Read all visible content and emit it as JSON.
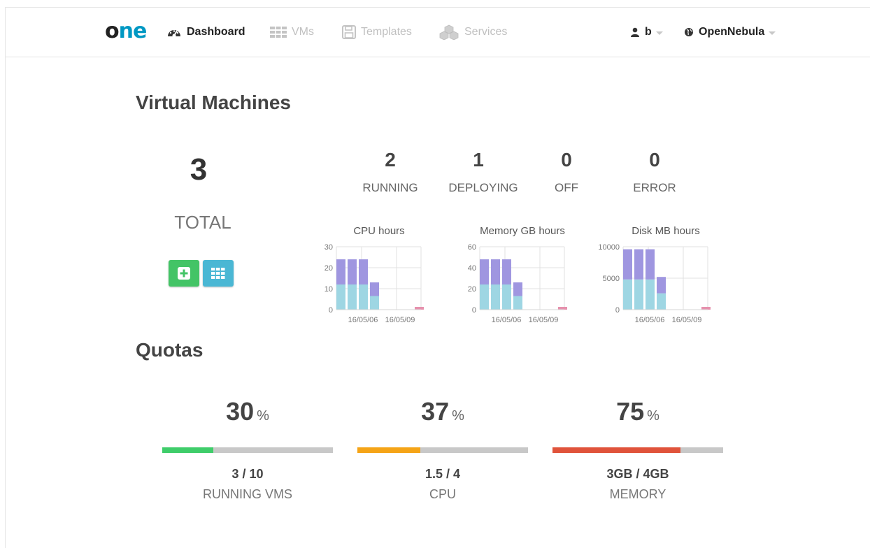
{
  "header": {
    "logo": {
      "left": "o",
      "right": "ne"
    },
    "nav": [
      {
        "label": "Dashboard",
        "active": true
      },
      {
        "label": "VMs",
        "active": false
      },
      {
        "label": "Templates",
        "active": false
      },
      {
        "label": "Services",
        "active": false
      }
    ],
    "user": "b",
    "zone": "OpenNebula"
  },
  "vms": {
    "title": "Virtual Machines",
    "total": "3",
    "total_label": "TOTAL",
    "states": [
      {
        "count": "2",
        "label": "RUNNING"
      },
      {
        "count": "1",
        "label": "DEPLOYING"
      },
      {
        "count": "0",
        "label": "OFF"
      },
      {
        "count": "0",
        "label": "ERROR"
      }
    ]
  },
  "chart_data": [
    {
      "type": "bar",
      "title": "CPU hours",
      "yticks": [
        "30",
        "20",
        "10",
        "0"
      ],
      "ylim": [
        0,
        30
      ],
      "xticks": [
        "16/05/06",
        "16/05/09"
      ],
      "stacked": true,
      "series": [
        {
          "values": [
            12,
            12,
            12,
            6.5,
            0,
            0,
            0,
            1.5
          ],
          "color": "#9ed6e3"
        },
        {
          "values": [
            12,
            12,
            12,
            6.5,
            0,
            0,
            0,
            0
          ],
          "color": "#9f96e0"
        }
      ],
      "highlight_color": "#e691ad"
    },
    {
      "type": "bar",
      "title": "Memory GB hours",
      "yticks": [
        "60",
        "40",
        "20",
        "0"
      ],
      "ylim": [
        0,
        60
      ],
      "xticks": [
        "16/05/06",
        "16/05/09"
      ],
      "stacked": true,
      "series": [
        {
          "values": [
            24,
            24,
            24,
            13,
            0,
            0,
            0,
            3
          ],
          "color": "#9ed6e3"
        },
        {
          "values": [
            24,
            24,
            24,
            13,
            0,
            0,
            0,
            0
          ],
          "color": "#9f96e0"
        }
      ],
      "highlight_color": "#e691ad"
    },
    {
      "type": "bar",
      "title": "Disk MB hours",
      "yticks": [
        "10000",
        "5000",
        "0"
      ],
      "ylim": [
        0,
        10000
      ],
      "xticks": [
        "16/05/06",
        "16/05/09"
      ],
      "stacked": true,
      "series": [
        {
          "values": [
            4800,
            4800,
            4800,
            2600,
            0,
            0,
            0,
            650
          ],
          "color": "#9ed6e3"
        },
        {
          "values": [
            4800,
            4800,
            4800,
            2600,
            0,
            0,
            0,
            0
          ],
          "color": "#9f96e0"
        }
      ],
      "highlight_color": "#e691ad"
    }
  ],
  "quotas": {
    "title": "Quotas",
    "unit": "%",
    "items": [
      {
        "pct": "30",
        "value": "3 / 10",
        "label": "RUNNING VMS",
        "fraction": 0.3,
        "color": "#3fcd6a"
      },
      {
        "pct": "37",
        "value": "1.5 / 4",
        "label": "CPU",
        "fraction": 0.37,
        "color": "#f5a417"
      },
      {
        "pct": "75",
        "value": "3GB / 4GB",
        "label": "MEMORY",
        "fraction": 0.75,
        "color": "#e0533b"
      }
    ]
  }
}
